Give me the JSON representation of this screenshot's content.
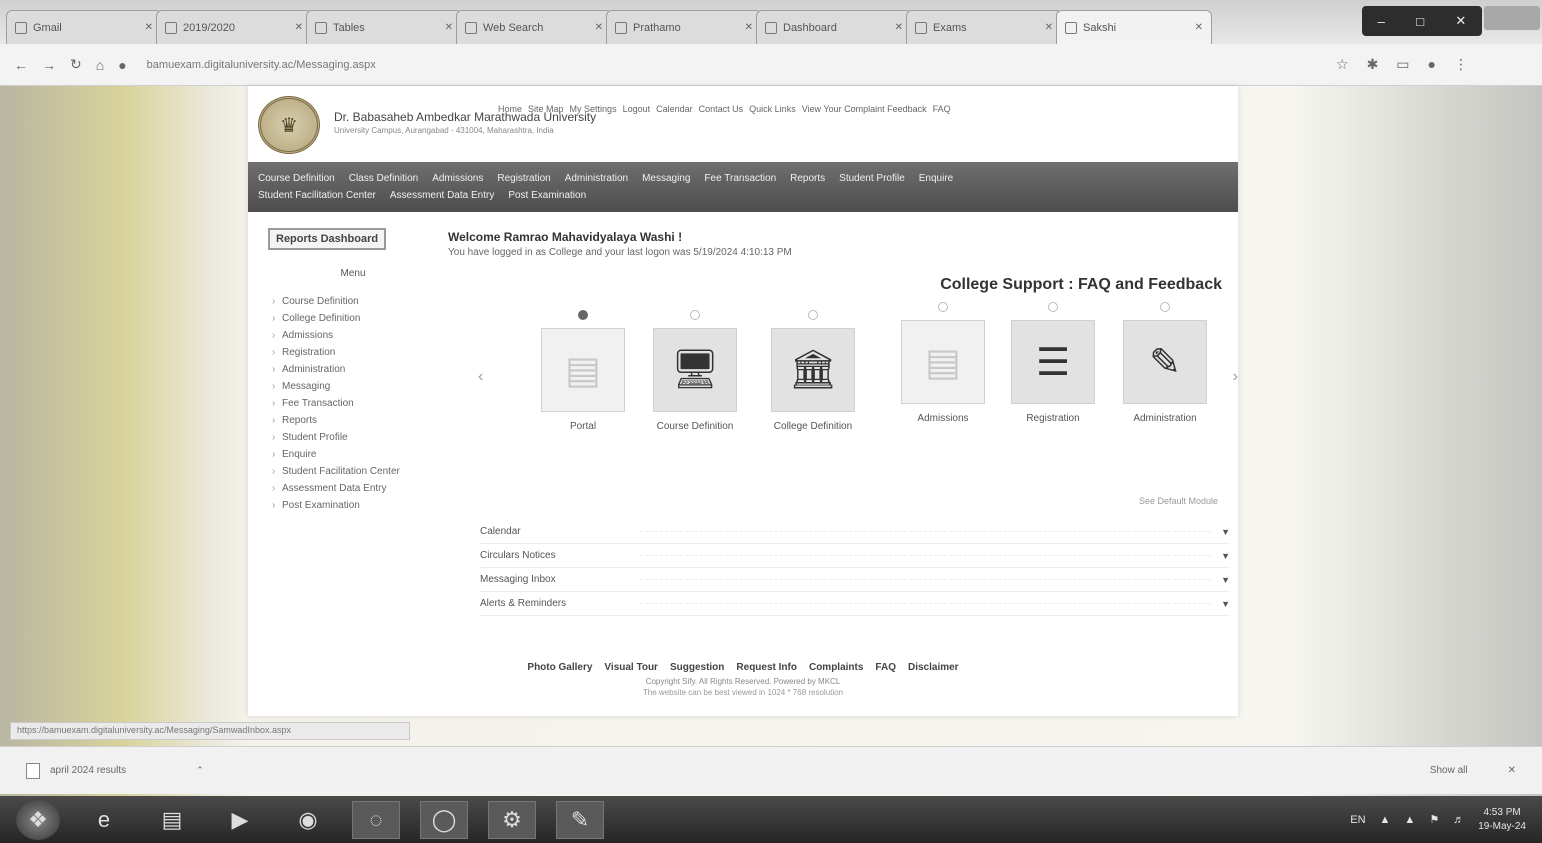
{
  "browser": {
    "tabs": [
      {
        "label": "Gmail",
        "active": false
      },
      {
        "label": "2019/2020",
        "active": false
      },
      {
        "label": "Tables",
        "active": false
      },
      {
        "label": "Web Search",
        "active": false
      },
      {
        "label": "Prathamo",
        "active": false
      },
      {
        "label": "Dashboard",
        "active": false
      },
      {
        "label": "Exams",
        "active": false
      },
      {
        "label": "Sakshi",
        "active": true
      }
    ],
    "url": "bamuexam.digitaluniversity.ac/Messaging.aspx"
  },
  "header": {
    "university_name": "Dr. Babasaheb Ambedkar Marathwada University",
    "university_sub": "University Campus, Aurangabad - 431004, Maharashtra, India",
    "top_links": [
      "Home",
      "Site Map",
      "My Settings",
      "Logout",
      "Calendar",
      "Contact Us",
      "Quick Links",
      "View Your Complaint Feedback",
      "FAQ"
    ]
  },
  "nav": {
    "row1": [
      "Course Definition",
      "Class Definition",
      "Admissions",
      "Registration",
      "Administration",
      "Messaging",
      "Fee Transaction",
      "Reports",
      "Student Profile",
      "Enquire"
    ],
    "row2": [
      "Student Facilitation Center",
      "Assessment Data Entry",
      "Post Examination"
    ]
  },
  "sidebar": {
    "title": "Reports Dashboard",
    "menu_label": "Menu",
    "items": [
      "Course Definition",
      "College Definition",
      "Admissions",
      "Registration",
      "Administration",
      "Messaging",
      "Fee Transaction",
      "Reports",
      "Student Profile",
      "Enquire",
      "Student Facilitation Center",
      "Assessment Data Entry",
      "Post Examination"
    ]
  },
  "main": {
    "welcome": "Welcome Ramrao Mahavidyalaya Washi !",
    "login_info": "You have logged in as College and your last logon was 5/19/2024 4:10:13 PM",
    "support_title": "College Support : FAQ and Feedback",
    "tiles": [
      {
        "label": "Portal",
        "icon": "portal-icon",
        "faded": true
      },
      {
        "label": "Course Definition",
        "icon": "monitor-icon",
        "faded": false
      },
      {
        "label": "College Definition",
        "icon": "building-icon",
        "faded": false
      },
      {
        "label": "Admissions",
        "icon": "admissions-icon",
        "faded": true
      },
      {
        "label": "Registration",
        "icon": "checklist-icon",
        "faded": false
      },
      {
        "label": "Administration",
        "icon": "user-edit-icon",
        "faded": false
      }
    ],
    "see_default": "See Default Module",
    "panels": [
      "Calendar",
      "Circulars Notices",
      "Messaging Inbox",
      "Alerts & Reminders"
    ]
  },
  "footer": {
    "links": [
      "Photo Gallery",
      "Visual Tour",
      "Suggestion",
      "Request Info",
      "Complaints",
      "FAQ",
      "Disclaimer"
    ],
    "copyright": "Copyright Sify. All Rights Reserved. Powered by MKCL",
    "note": "The website can be best viewed in 1024 * 768 resolution"
  },
  "status_url": "https://bamuexam.digitaluniversity.ac/Messaging/SamwadInbox.aspx",
  "download": {
    "file_name": "april 2024 results",
    "show_all": "Show all"
  },
  "taskbar": {
    "lang": "EN",
    "time": "4:53 PM",
    "date": "19-May-24"
  }
}
